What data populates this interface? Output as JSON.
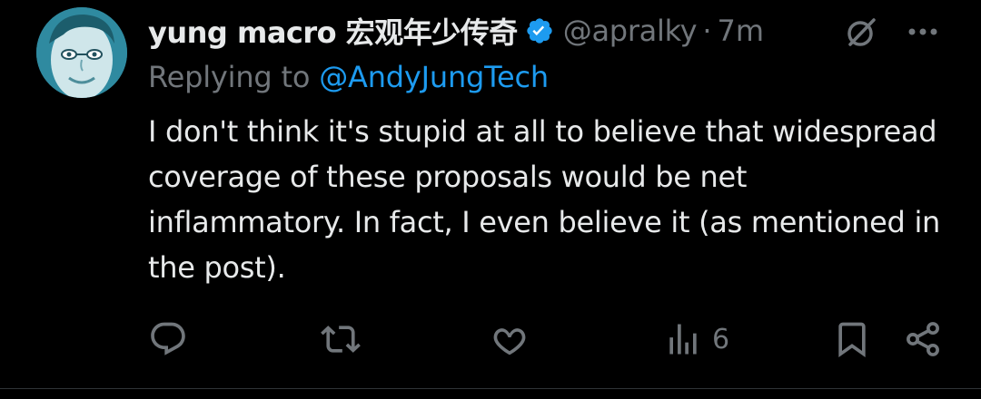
{
  "tweet": {
    "display_name": "yung macro 宏观年少传奇",
    "handle": "@apralky",
    "separator": "·",
    "time": "7m",
    "replying_prefix": "Replying to",
    "replying_to": "@AndyJungTech",
    "text": "I don't think it's stupid at all to believe that widespread coverage of these proposals would be net inflammatory. In fact, I even believe it (as mentioned in the post)."
  },
  "actions": {
    "reply_icon": "reply-icon",
    "retweet_icon": "retweet-icon",
    "like_icon": "heart-icon",
    "views_icon": "views-icon",
    "views_count": "6",
    "bookmark_icon": "bookmark-icon",
    "share_icon": "share-icon"
  },
  "colors": {
    "background": "#000000",
    "text_primary": "#e7e9ea",
    "text_secondary": "#71767b",
    "accent": "#1d9bf0",
    "verified": "#1d9bf0"
  }
}
